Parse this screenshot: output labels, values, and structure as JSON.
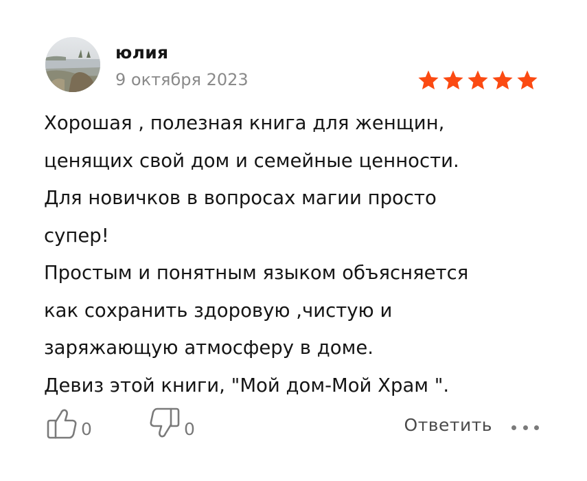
{
  "review": {
    "author": "юлия",
    "date": "9 октября 2023",
    "rating": 5,
    "rating_max": 5,
    "star_color": "#fb4a12",
    "text_lines": [
      "Хорошая , полезная книга для женщин,",
      "ценящих свой дом и семейные ценности.",
      "Для новичков в вопросах магии просто",
      "супер!",
      "Простым и понятным языком объясняется",
      "как сохранить здоровую ,чистую и",
      "заряжающую атмосферу в доме.",
      "Девиз этой книги, \"Мой дом-Мой Храм \"."
    ]
  },
  "footer": {
    "likes": "0",
    "dislikes": "0",
    "reply_label": "Ответить",
    "like_icon": "thumbs-up-icon",
    "dislike_icon": "thumbs-down-icon",
    "more_icon": "more-dots-icon"
  }
}
